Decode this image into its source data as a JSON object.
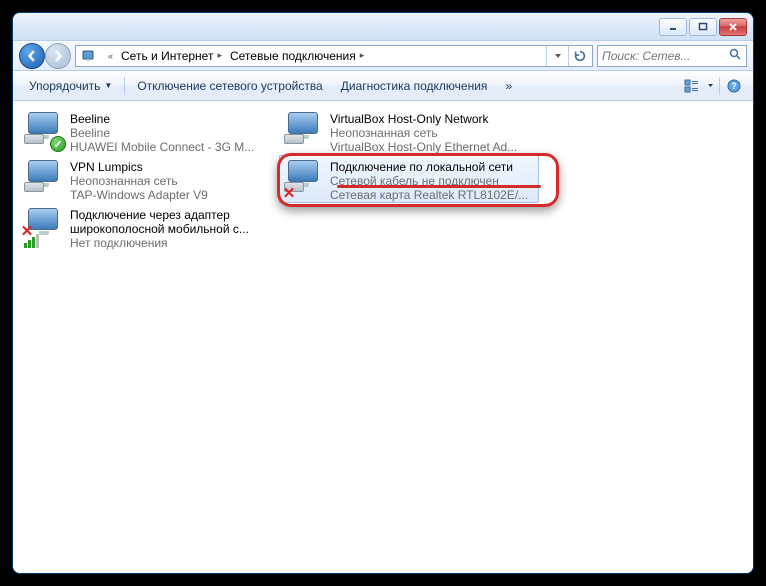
{
  "breadcrumbs": {
    "icon": "network",
    "items": [
      "Сеть и Интернет",
      "Сетевые подключения"
    ]
  },
  "search": {
    "placeholder": "Поиск: Сетев..."
  },
  "toolbar": {
    "organize": "Упорядочить",
    "disable": "Отключение сетевого устройства",
    "diagnose": "Диагностика подключения",
    "more": "»"
  },
  "connections": [
    {
      "name": "Beeline",
      "status": "Beeline",
      "device": "HUAWEI Mobile Connect - 3G M...",
      "overlay": "ok"
    },
    {
      "name": "VirtualBox Host-Only Network",
      "status": "Неопознанная сеть",
      "device": "VirtualBox Host-Only Ethernet Ad...",
      "overlay": "none"
    },
    {
      "name": "VPN Lumpics",
      "status": "Неопознанная сеть",
      "device": "TAP-Windows Adapter V9",
      "overlay": "none"
    },
    {
      "name": "Подключение по локальной сети",
      "status": "Сетевой кабель не подключен",
      "device": "Сетевая карта Realtek RTL8102E/...",
      "overlay": "x",
      "selected": true
    },
    {
      "name": "Подключение через адаптер широкополосной мобильной с...",
      "status": "Нет подключения",
      "device": "",
      "overlay": "bars-x"
    }
  ]
}
